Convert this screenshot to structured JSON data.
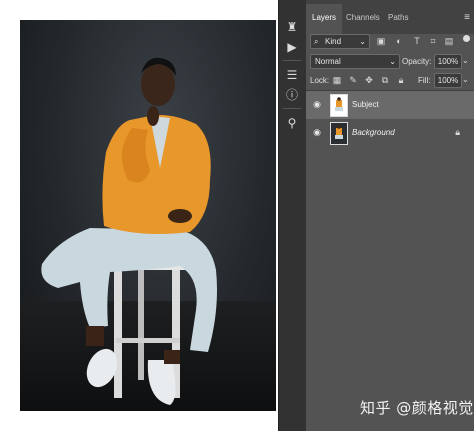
{
  "panel": {
    "tabs": [
      {
        "label": "Layers",
        "active": true
      },
      {
        "label": "Channels",
        "active": false
      },
      {
        "label": "Paths",
        "active": false
      }
    ],
    "search_icon": "search-icon",
    "filter_kind": "Kind",
    "filter_icons": [
      "image-filter-icon",
      "adjustment-filter-icon",
      "type-filter-icon",
      "shape-filter-icon",
      "smart-object-filter-icon"
    ],
    "blend_mode": "Normal",
    "opacity_label": "Opacity:",
    "opacity_value": "100%",
    "lock_label": "Lock:",
    "lock_icons": [
      "lock-transparent-icon",
      "lock-image-icon",
      "lock-position-icon",
      "lock-artboard-icon",
      "lock-all-icon"
    ],
    "fill_label": "Fill:",
    "fill_value": "100%",
    "layers": [
      {
        "name": "Subject",
        "selected": true,
        "visible": true,
        "locked": false
      },
      {
        "name": "Background",
        "selected": false,
        "visible": true,
        "locked": true
      }
    ]
  },
  "tools": [
    "history-brush-icon",
    "play-icon",
    "properties-icon",
    "info-icon",
    "clone-source-icon"
  ],
  "watermark": "知乎 @颜格视觉",
  "colors": {
    "panel_bg": "#535353",
    "tab_bar": "#424242",
    "selected_layer": "#6a6a6a",
    "jacket": "#e8972a",
    "pants": "#c9d8df"
  }
}
